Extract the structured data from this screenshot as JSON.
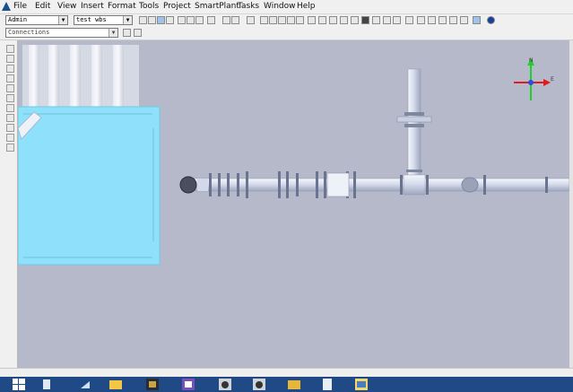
{
  "menubar": {
    "items": [
      "File",
      "Edit",
      "View",
      "Insert",
      "Format",
      "Tools",
      "Project",
      "SmartPlant",
      "Tasks",
      "Window",
      "Help"
    ]
  },
  "toolbar1": {
    "user_combo": "Admin",
    "wbs_combo": "test wbs"
  },
  "toolbar2": {
    "filter_combo": "Connections"
  },
  "compass": {
    "north_label": "N",
    "east_label": "E",
    "colors": {
      "north": "#1fcf2a",
      "east": "#e21b1b",
      "up": "#2a4fe0"
    }
  },
  "colors": {
    "viewport_bg": "#b6b9c9",
    "pipe": "#cfd6e8",
    "equipment": "#8ee0fb",
    "taskbar": "#1f4a86"
  },
  "taskbar": {
    "icons": [
      "start-icon",
      "search-icon",
      "task-view-icon",
      "file-explorer-icon",
      "app-icon",
      "visual-studio-icon",
      "photoshop-icon",
      "photoshop-icon",
      "folder-icon",
      "document-icon",
      "app-icon"
    ]
  }
}
